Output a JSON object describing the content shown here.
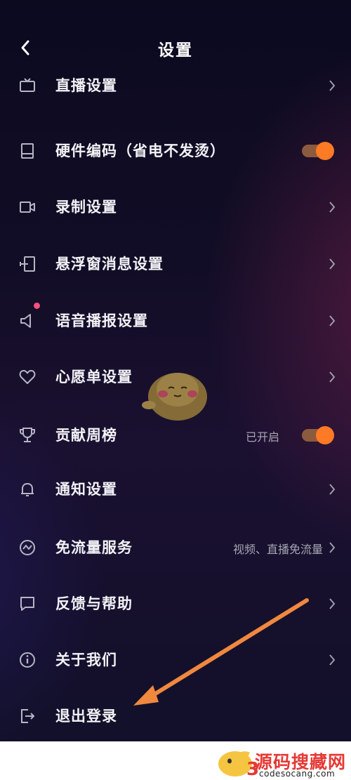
{
  "header": {
    "title": "设置"
  },
  "rows": [
    {
      "label": "直播设置"
    },
    {
      "label": "硬件编码（省电不发烫）"
    },
    {
      "label": "录制设置"
    },
    {
      "label": "悬浮窗消息设置"
    },
    {
      "label": "语音播报设置"
    },
    {
      "label": "心愿单设置"
    },
    {
      "label": "贡献周榜",
      "value": "已开启"
    },
    {
      "label": "通知设置"
    },
    {
      "label": "免流量服务",
      "value": "视频、直播免流量"
    },
    {
      "label": "反馈与帮助"
    },
    {
      "label": "关于我们"
    },
    {
      "label": "退出登录"
    }
  ],
  "toggles": {
    "hardware_encoding": true,
    "contribution_weekly": true
  },
  "icons": [
    "tv-icon",
    "cpu-icon",
    "video-camera-icon",
    "floating-window-icon",
    "speaker-icon",
    "heart-icon",
    "trophy-icon",
    "bell-icon",
    "data-saver-icon",
    "feedback-icon",
    "info-icon",
    "logout-icon"
  ],
  "colors": {
    "accent": "#ff7a25",
    "toggle_track": "#8c5a3c",
    "badge_dot": "#ff4f7f",
    "arrow": "#f0883e"
  },
  "watermark": {
    "text": "源码搜藏网",
    "url": "codesocang.com",
    "logo_char": "3"
  }
}
